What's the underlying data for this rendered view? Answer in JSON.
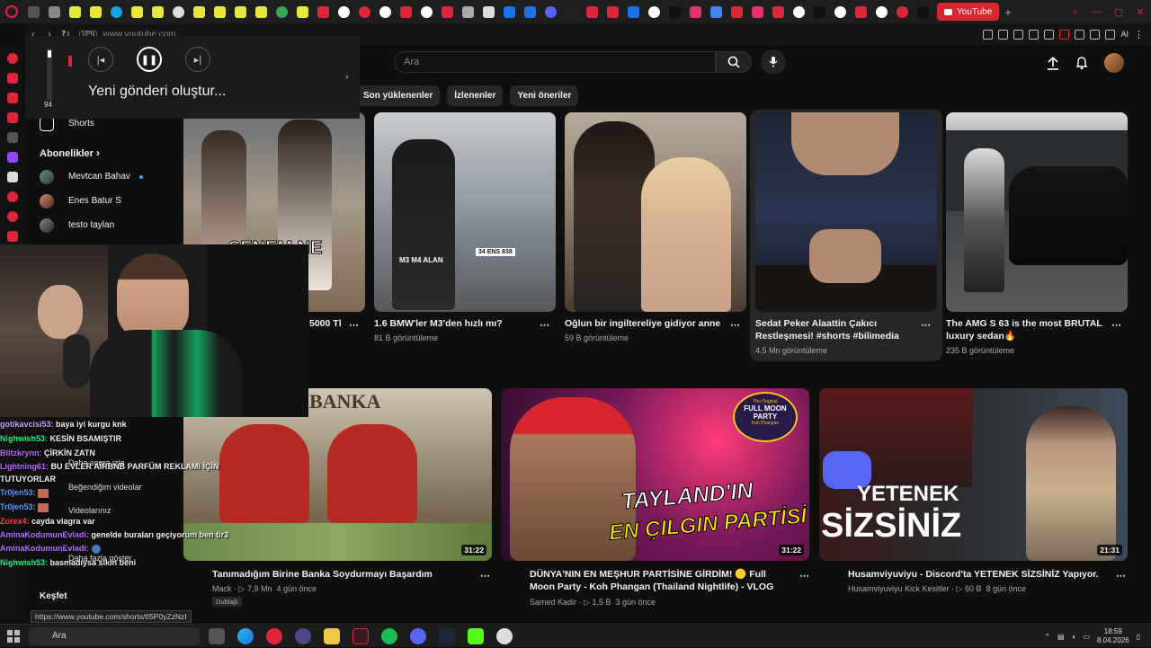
{
  "browser": {
    "active_tab_label": "YouTube",
    "url": "www.youtube.com",
    "vpn_label": "VPN",
    "addr_ai_label": "AI",
    "status_url": "https://www.youtube.com/shorts/tI5P0yZzNzI"
  },
  "youtube": {
    "search_placeholder": "Ara",
    "chips": [
      "Son yüklenenler",
      "İzlenenler",
      "Yeni öneriler"
    ],
    "guide": {
      "shorts_label": "Shorts",
      "subscriptions_heading": "Abonelikler",
      "subscriptions": [
        "Mevtcan Bahav",
        "Enes Batur S",
        "testo taylan"
      ],
      "explore_label": "Keşfet"
    },
    "shorts": [
      {
        "title": "5000 Tl",
        "views": ""
      },
      {
        "title": "1.6 BMW'ler M3'den hızlı mı?",
        "views": "81 B görüntüleme"
      },
      {
        "title": "Oğlun bir ingiltereliye gidiyor anne",
        "views": "59 B görüntüleme"
      },
      {
        "title": "Sedat Peker Alaattin Çakıcı Restleşmesi! #shorts #bilimedia",
        "views": "4,5 Mn görüntüleme"
      },
      {
        "title": "The AMG S 63 is the most BRUTAL luxury sedan🔥",
        "views": "235 B görüntüleme"
      }
    ],
    "shorts_overlay_texts": {
      "bmw_plate": "34 ENS 838",
      "bmw_caption": "M3 M4 ALAN",
      "first_caption": "SENEM NE YAPIYOR"
    },
    "videos": [
      {
        "title": "Tanımadığım Birine Banka Soydurmayı Başardım",
        "channel": "Mack",
        "views": "7,9 Mn",
        "age": "4 gün önce",
        "badge": "Dublajlı",
        "duration": "31:22",
        "thumb_text": "BANKA"
      },
      {
        "title": "DÜNYA'NIN EN MEŞHUR PARTİSİNE GİRDİM! 🟡 Full Moon Party - Koh Phangan (Thailand Nightlife) - VLOG",
        "channel": "Samed Kadir",
        "views": "1,5 B",
        "age": "3 gün önce",
        "duration": "31:22",
        "thumb_line1": "TAYLAND'IN",
        "thumb_line2": "EN ÇILGIN PARTİSİ",
        "thumb_tag1": "FULL MOON",
        "thumb_tag2": "PARTY",
        "thumb_tag3": "Koh Phangan",
        "thumb_tag_top": "The Original"
      },
      {
        "title": "Husamviyuviyu - Discord'ta YETENEK SİZSİNİZ Yapıyor.",
        "channel": "Husamviyuviyu Kick Kesitler",
        "views": "60 B",
        "age": "8 gün önce",
        "duration": "21:31",
        "thumb_line1": "YETENEK",
        "thumb_line2": "SİZSİNİZ"
      }
    ]
  },
  "media_overlay": {
    "title": "Yeni gönderi oluştur...",
    "volume_level": "94"
  },
  "chat": [
    {
      "user": "gotikavcisi53:",
      "msg": "baya iyi kurgu knk",
      "color": "#c8a0ff"
    },
    {
      "user": "Nighwish53:",
      "msg": "KESİN BSAMIŞTIR",
      "color": "#00ff7f"
    },
    {
      "user": "Blitzkrynn:",
      "msg": "ÇİRKİN ZATN",
      "color": "#b56bff"
    },
    {
      "user": "Lightning61:",
      "msg": "BU EVLER AİRBNB PARFÜM REKLAMI İÇİN TUTUYORLAR",
      "color": "#b56bff"
    },
    {
      "user": "Tr0jen53:",
      "msg": "",
      "color": "#5b9bff"
    },
    {
      "user": "Tr0jen53:",
      "msg": "",
      "color": "#5b9bff"
    },
    {
      "user": "Zorex4:",
      "msg": "cayda viagra var",
      "color": "#ff4040"
    },
    {
      "user": "AminaKodumunEvladi:",
      "msg": "genelde buraları geçiyorum ben tir3",
      "color": "#b56bff"
    },
    {
      "user": "AminaKodumunEvladi:",
      "msg": "",
      "color": "#b56bff"
    },
    {
      "user": "Nighwish53:",
      "msg": "basmadıysa sikin beni",
      "color": "#00ff7f"
    }
  ],
  "ghost_menu": [
    "Daha sonra izle",
    "Beğendiğim videolar",
    "Videolarınız",
    "Daha fazla göster"
  ],
  "taskbar": {
    "search_label": "Ara",
    "time": "18:59",
    "date": "8.04.2026"
  },
  "colors": {
    "accent": "#e0273a",
    "bg": "#0f0f0f",
    "chip": "#272727"
  }
}
